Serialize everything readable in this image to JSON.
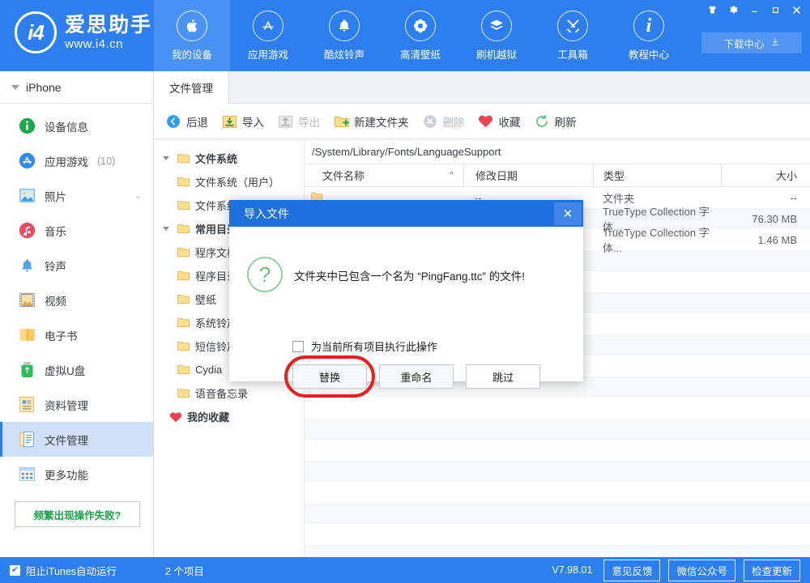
{
  "header": {
    "brand_mark": "i4",
    "brand_name": "爱思助手",
    "brand_url": "www.i4.cn",
    "nav": [
      {
        "label": "我的设备",
        "icon": "apple-icon",
        "active": true
      },
      {
        "label": "应用游戏",
        "icon": "appstore-icon",
        "active": false
      },
      {
        "label": "酷炫铃声",
        "icon": "bell-icon",
        "active": false
      },
      {
        "label": "高清壁纸",
        "icon": "flower-icon",
        "active": false
      },
      {
        "label": "刷机越狱",
        "icon": "stack-icon",
        "active": false
      },
      {
        "label": "工具箱",
        "icon": "tools-icon",
        "active": false
      },
      {
        "label": "教程中心",
        "icon": "info-icon",
        "active": false
      }
    ],
    "window_controls": [
      {
        "name": "skin-icon",
        "glyph": "👕"
      },
      {
        "name": "settings-gear-icon",
        "glyph": "✿"
      },
      {
        "name": "minimize-icon",
        "glyph": "—"
      },
      {
        "name": "maximize-icon",
        "glyph": "▢"
      },
      {
        "name": "close-icon",
        "glyph": "✕"
      }
    ],
    "download_center": "下载中心",
    "download_center_icon": "download-icon"
  },
  "sidebar": {
    "device_name": "iPhone",
    "items": [
      {
        "label": "设备信息",
        "icon": "info-circle-icon",
        "count": "",
        "chevron": false,
        "active": false
      },
      {
        "label": "应用游戏",
        "icon": "appstore-circle-icon",
        "count": "(10)",
        "chevron": false,
        "active": false
      },
      {
        "label": "照片",
        "icon": "photo-icon",
        "count": "",
        "chevron": true,
        "active": false
      },
      {
        "label": "音乐",
        "icon": "music-icon",
        "count": "",
        "chevron": false,
        "active": false
      },
      {
        "label": "铃声",
        "icon": "bell-blue-icon",
        "count": "",
        "chevron": false,
        "active": false
      },
      {
        "label": "视频",
        "icon": "film-icon",
        "count": "",
        "chevron": false,
        "active": false
      },
      {
        "label": "电子书",
        "icon": "book-icon",
        "count": "",
        "chevron": false,
        "active": false
      },
      {
        "label": "虚拟U盘",
        "icon": "usb-icon",
        "count": "",
        "chevron": false,
        "active": false
      },
      {
        "label": "资料管理",
        "icon": "docs-icon",
        "count": "",
        "chevron": false,
        "active": false
      },
      {
        "label": "文件管理",
        "icon": "files-icon",
        "count": "",
        "chevron": false,
        "active": true
      },
      {
        "label": "更多功能",
        "icon": "grid-icon",
        "count": "",
        "chevron": false,
        "active": false
      }
    ],
    "fail_button": "频繁出现操作失败?",
    "itunes_checkbox_label": "阻止iTunes自动运行",
    "itunes_checkbox_checked": true,
    "itunes_check_glyph": "✔"
  },
  "main": {
    "tabs": [
      {
        "label": "文件管理",
        "active": true
      }
    ],
    "toolbar": [
      {
        "label": "后退",
        "icon": "back-arrow-icon",
        "disabled": false
      },
      {
        "label": "导入",
        "icon": "import-icon",
        "disabled": false
      },
      {
        "label": "导出",
        "icon": "export-icon",
        "disabled": true
      },
      {
        "label": "新建文件夹",
        "icon": "new-folder-icon",
        "disabled": false
      },
      {
        "label": "删除",
        "icon": "delete-icon",
        "disabled": true
      },
      {
        "label": "收藏",
        "icon": "heart-icon",
        "disabled": false
      },
      {
        "label": "刷新",
        "icon": "refresh-icon",
        "disabled": false
      }
    ],
    "tree": [
      {
        "label": "文件系统",
        "depth": 0,
        "expanded": true,
        "bold": true,
        "icon": "folder-icon"
      },
      {
        "label": "文件系统（用户）",
        "depth": 1,
        "expanded": null,
        "bold": false,
        "icon": "folder-icon"
      },
      {
        "label": "文件系统（越狱）",
        "depth": 1,
        "expanded": null,
        "bold": false,
        "icon": "folder-icon"
      },
      {
        "label": "常用目录",
        "depth": 0,
        "expanded": true,
        "bold": true,
        "icon": "folder-icon"
      },
      {
        "label": "程序文档",
        "depth": 1,
        "expanded": null,
        "bold": false,
        "icon": "folder-icon"
      },
      {
        "label": "程序目录",
        "depth": 1,
        "expanded": null,
        "bold": false,
        "icon": "folder-icon"
      },
      {
        "label": "壁纸",
        "depth": 1,
        "expanded": null,
        "bold": false,
        "icon": "folder-icon"
      },
      {
        "label": "系统铃声",
        "depth": 1,
        "expanded": null,
        "bold": false,
        "icon": "folder-icon"
      },
      {
        "label": "短信铃声",
        "depth": 1,
        "expanded": null,
        "bold": false,
        "icon": "folder-icon"
      },
      {
        "label": "Cydia",
        "depth": 1,
        "expanded": null,
        "bold": false,
        "icon": "folder-icon"
      },
      {
        "label": "语音备忘录",
        "depth": 1,
        "expanded": null,
        "bold": false,
        "icon": "folder-icon"
      },
      {
        "label": "我的收藏",
        "depth": 0,
        "expanded": null,
        "bold": true,
        "icon": "heart-icon"
      }
    ],
    "path": "/System/Library/Fonts/LanguageSupport",
    "columns": [
      "文件名称",
      "修改日期",
      "类型",
      "大小"
    ],
    "sort_indicator": "^",
    "rows": [
      {
        "name": "..",
        "date": "--",
        "type": "文件夹",
        "size": "--",
        "icon": "folder-icon"
      },
      {
        "name": "",
        "date": "",
        "type": "TrueType Collection 字体...",
        "size": "76.30 MB",
        "icon": "file-icon"
      },
      {
        "name": "",
        "date": "",
        "type": "TrueType Collection 字体...",
        "size": "1.46 MB",
        "icon": "file-icon"
      }
    ]
  },
  "statusbar": {
    "item_count": "2 个项目",
    "version": "V7.98.01",
    "buttons": [
      "意见反馈",
      "微信公众号",
      "检查更新"
    ]
  },
  "dialog": {
    "title": "导入文件",
    "close_glyph": "✕",
    "icon": "question-mark-icon",
    "icon_glyph": "?",
    "message": "文件夹中已包含一个名为 “PingFang.ttc” 的文件!",
    "checkbox_label": "为当前所有项目执行此操作",
    "checkbox_checked": false,
    "buttons": [
      {
        "label": "替换",
        "highlighted": true
      },
      {
        "label": "重命名",
        "highlighted": false
      },
      {
        "label": "跳过",
        "highlighted": false
      }
    ]
  },
  "colors": {
    "brand_blue": "#2d7ff0",
    "nav_active": "#4a93f5",
    "sidebar_active": "#cfe0f8",
    "dialog_title": "#1f6fe0",
    "highlight_ring": "#ee1c1c",
    "green_text": "#1aa34a"
  }
}
